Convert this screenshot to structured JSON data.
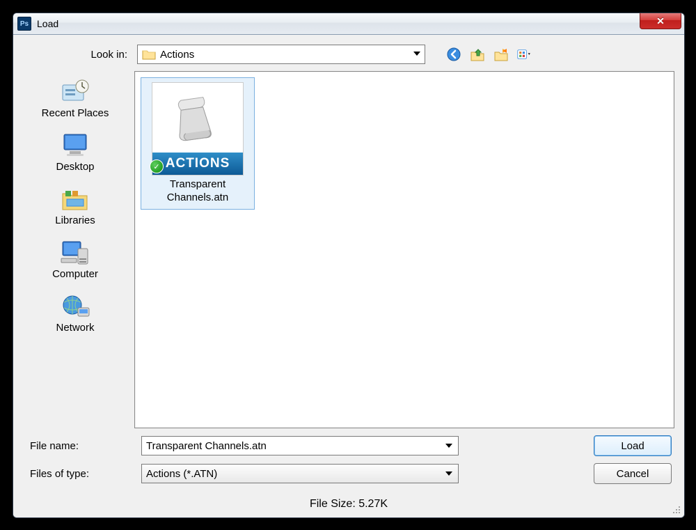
{
  "window": {
    "title": "Load"
  },
  "lookin": {
    "label": "Look in:",
    "value": "Actions"
  },
  "toolbar": {
    "back": "back-icon",
    "up": "up-one-level-icon",
    "newfolder": "new-folder-icon",
    "viewmenu": "view-menu-icon"
  },
  "places": {
    "recent": "Recent Places",
    "desktop": "Desktop",
    "libraries": "Libraries",
    "computer": "Computer",
    "network": "Network"
  },
  "file": {
    "thumb_label": "ACTIONS",
    "name": "Transparent Channels.atn"
  },
  "form": {
    "filename_label": "File name:",
    "filename_value": "Transparent Channels.atn",
    "filetype_label": "Files of type:",
    "filetype_value": "Actions (*.ATN)"
  },
  "buttons": {
    "load": "Load",
    "cancel": "Cancel"
  },
  "status": {
    "filesize": "File Size: 5.27K"
  }
}
